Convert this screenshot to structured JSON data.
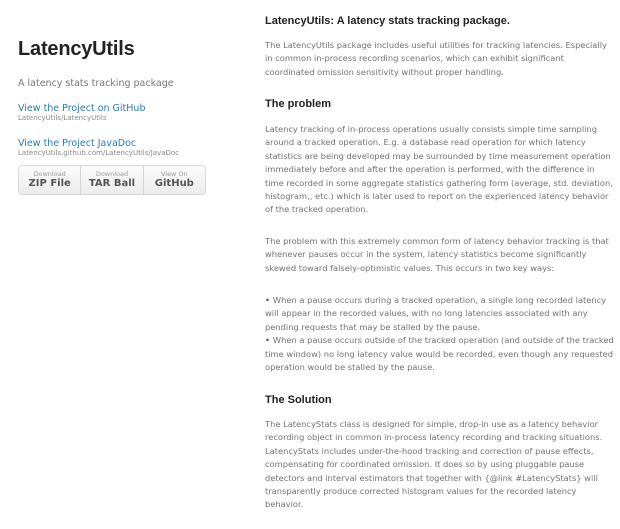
{
  "sidebar": {
    "title": "LatencyUtils",
    "tagline": "A latency stats tracking package",
    "github_link": "View the Project on GitHub",
    "github_small": "LatencyUtils/LatencyUtils",
    "javadoc_link": "View the Project JavaDoc",
    "javadoc_small": "LatencyUtils.github.com/LatencyUtils/JavaDoc",
    "downloads": [
      {
        "top": "Download",
        "main": "ZIP File"
      },
      {
        "top": "Download",
        "main": "TAR Ball"
      },
      {
        "top": "View On",
        "main": "GitHub"
      }
    ]
  },
  "main": {
    "heading": "LatencyUtils: A latency stats tracking package.",
    "intro": "The LatencyUtils package includes useful utilities for tracking latencies. Especially in common in-process recording scenarios, which can exhibit significant coordinated omission sensitivity without proper handling.",
    "problem_heading": "The problem",
    "problem_p1": "Latency tracking of in-process operations usually consists simple time sampling around a tracked operation. E.g. a database read operation for which latency statistics are being developed may be surrounded by time measurement operation immediately before and after the operation is performed, with the difference in time recorded in some aggregate statistics gathering form (average, std. deviation, histogram,, etc.) which is later used to report on the experienced latency behavior of the tracked operation.",
    "problem_p2": "The problem with this extremely common form of latency behavior tracking is that whenever pauses occur in the system, latency statistics become significantly skewed toward falsely-optimistic values. This occurs in two key ways:",
    "bullets": [
      "When a pause occurs during a tracked operation, a single long recorded latency will appear in the recorded values, with no long latencies associated with any pending requests that may be stalled by the pause.",
      "When a pause occurs outside of the tracked operation (and outside of the tracked time window) no long latency value would be recorded, even though any requested operation would be stalled by the pause."
    ],
    "solution_heading": "The Solution",
    "solution_p": "The LatencyStats class is designed for simple, drop-in use as a latency behavior recording object in common in-process latency recording and tracking situations. LatencyStats includes under-the-hood tracking and correction of pause effects, compensating for coordinated omission. It does so by using pluggable pause detectors and interval estimators that together with {@link #LatencyStats} will transparently produce corrected histogram values for the recorded latency behavior."
  }
}
